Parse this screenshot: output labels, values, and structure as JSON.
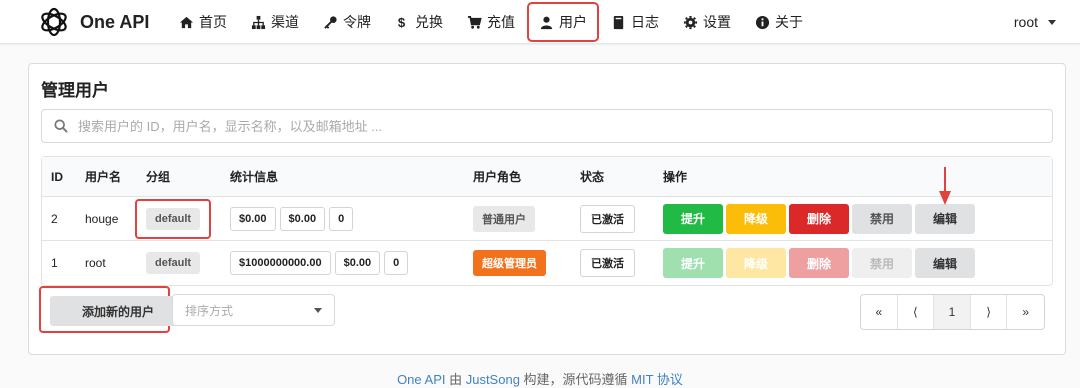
{
  "brand": {
    "name": "One API"
  },
  "nav": [
    {
      "label": "首页",
      "icon": "home-icon"
    },
    {
      "label": "渠道",
      "icon": "sitemap-icon"
    },
    {
      "label": "令牌",
      "icon": "key-icon"
    },
    {
      "label": "兑换",
      "icon": "dollar-icon"
    },
    {
      "label": "充值",
      "icon": "cart-icon"
    },
    {
      "label": "用户",
      "icon": "user-icon",
      "highlighted": true
    },
    {
      "label": "日志",
      "icon": "book-icon"
    },
    {
      "label": "设置",
      "icon": "gear-icon"
    },
    {
      "label": "关于",
      "icon": "info-icon"
    }
  ],
  "user_menu": {
    "label": "root"
  },
  "card": {
    "title": "管理用户",
    "search_placeholder": "搜索用户的 ID，用户名，显示名称，以及邮箱地址 ..."
  },
  "table": {
    "headers": [
      "ID",
      "用户名",
      "分组",
      "统计信息",
      "用户角色",
      "状态",
      "操作"
    ],
    "rows": [
      {
        "id": "2",
        "username": "houge",
        "group": "default",
        "stats": [
          "$0.00",
          "$0.00",
          "0"
        ],
        "role": "普通用户",
        "status": "已激活"
      },
      {
        "id": "1",
        "username": "root",
        "group": "default",
        "stats": [
          "$1000000000.00",
          "$0.00",
          "0"
        ],
        "role": "超级管理员",
        "status": "已激活"
      }
    ],
    "actions": {
      "promote": "提升",
      "demote": "降级",
      "delete": "删除",
      "disable": "禁用",
      "edit": "编辑"
    }
  },
  "add_button": "添加新的用户",
  "sort": {
    "placeholder": "排序方式"
  },
  "pagination": {
    "first": "«",
    "prev": "⟨",
    "current": "1",
    "next": "⟩",
    "last": "»"
  },
  "footer": {
    "part1": "One API",
    "part2": " 由 ",
    "part3": "JustSong",
    "part4": " 构建，源代码遵循 ",
    "part5": "MIT 协议"
  },
  "colors": {
    "highlight": "#e0433f",
    "promote": "#21ba45",
    "demote": "#fbbd08",
    "delete": "#db2828",
    "admin": "#f2711c",
    "link": "#4183c4"
  }
}
